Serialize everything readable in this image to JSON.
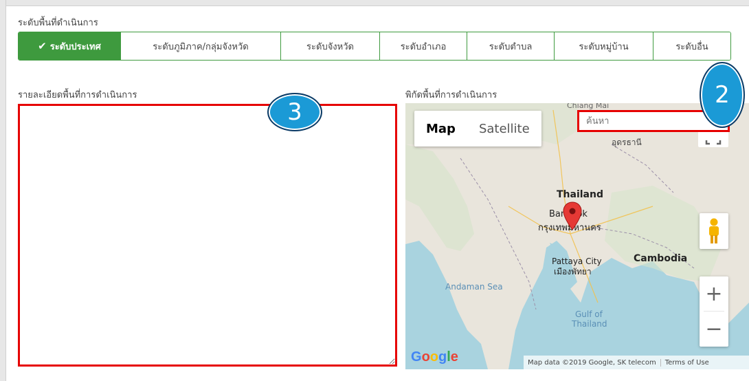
{
  "area_level": {
    "label": "ระดับพื้นที่ดำเนินการ",
    "options": [
      {
        "label": "ระดับประเทศ",
        "active": true
      },
      {
        "label": "ระดับภูมิภาค/กลุ่มจังหวัด",
        "active": false
      },
      {
        "label": "ระดับจังหวัด",
        "active": false
      },
      {
        "label": "ระดับอำเภอ",
        "active": false
      },
      {
        "label": "ระดับตำบล",
        "active": false
      },
      {
        "label": "ระดับหมู่บ้าน",
        "active": false
      },
      {
        "label": "ระดับอื่น",
        "active": false
      }
    ],
    "active_color": "#3e9a3e"
  },
  "details": {
    "label": "รายละเอียดพื้นที่การดำเนินการ",
    "value": ""
  },
  "map": {
    "label": "พิกัดพื้นที่การดำเนินการ",
    "type_map": "Map",
    "type_satellite": "Satellite",
    "search_placeholder": "ค้นหา",
    "places": {
      "chiang_mai": "Chiang Mai",
      "thailand": "Thailand",
      "bangkok_en": "Bangkok",
      "bangkok_th": "กรุงเทพมหานคร",
      "pattaya_en": "Pattaya City",
      "pattaya_th": "เมืองพัทยา",
      "cambodia": "Cambodia",
      "andaman": "Andaman Sea",
      "gulf": "Gulf of",
      "gulf2": "Thailand",
      "udon": "อุดรธานี"
    },
    "zoom_in": "+",
    "zoom_out": "−",
    "logo": "Google",
    "attribution": "Map data ©2019 Google, SK telecom",
    "terms": "Terms of Use"
  },
  "callouts": {
    "details": "3",
    "search": "2"
  },
  "highlight_color": "#e60000"
}
